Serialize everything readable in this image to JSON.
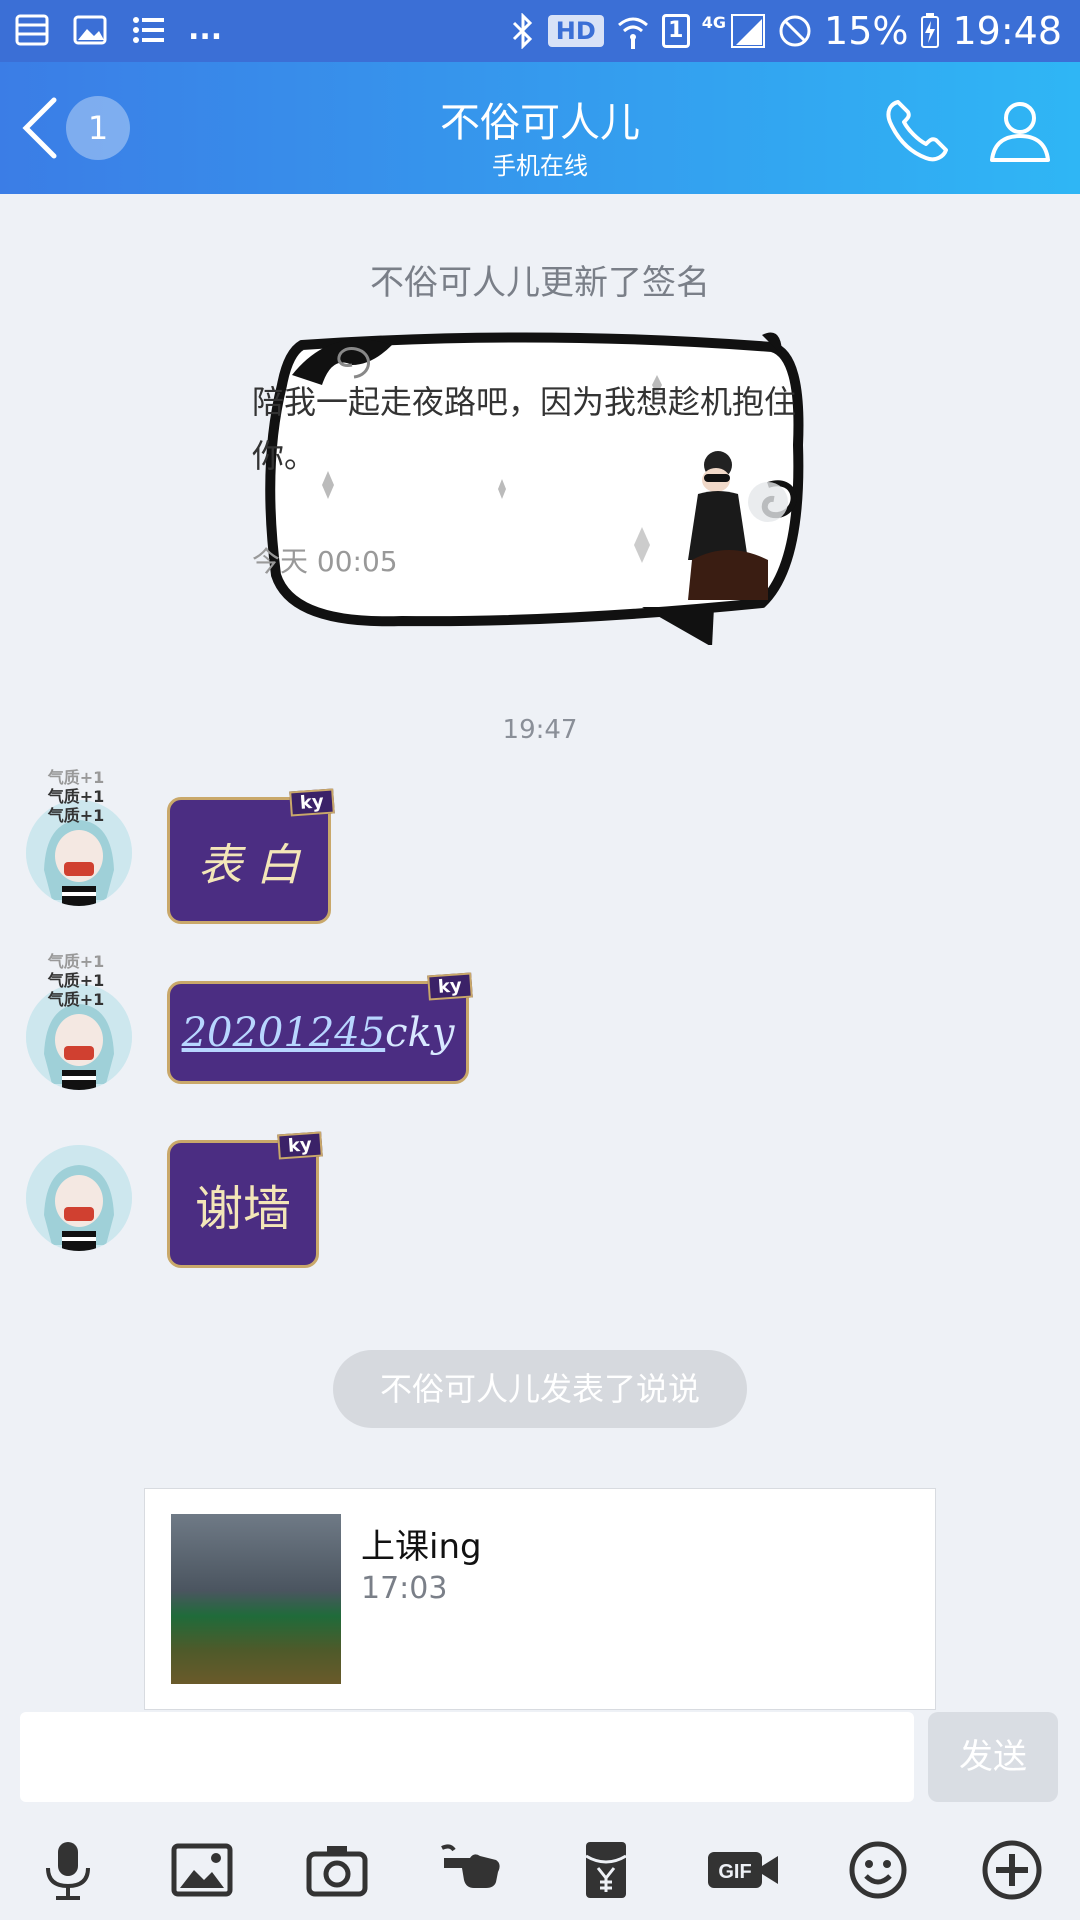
{
  "status_bar": {
    "network_badge": "HD",
    "sim_slot": "1",
    "network_type": "4G",
    "battery_percent": "15%",
    "time": "19:48",
    "overflow": "..."
  },
  "header": {
    "unread_count": "1",
    "title": "不俗可人儿",
    "subtitle": "手机在线"
  },
  "messages": {
    "signature_notice": "不俗可人儿更新了签名",
    "signature_text": "陪我一起走夜路吧，因为我想趁机抱住你。",
    "signature_time": "今天 00:05",
    "time_divider": "19:47",
    "avatar_tags": [
      "气质+1",
      "气质+1",
      "气质+1"
    ],
    "bubble_badge": "ky",
    "bubble1_text": "表 白",
    "bubble2_link": "20201245",
    "bubble2_suffix": "cky",
    "bubble3_text": "谢墙",
    "post_notice": "不俗可人儿发表了说说",
    "post_title": "上课ing",
    "post_time": "17:03"
  },
  "input": {
    "placeholder": "",
    "send_label": "发送"
  },
  "toolbar": {
    "icons": [
      "microphone-icon",
      "image-icon",
      "camera-icon",
      "poke-icon",
      "red-packet-icon",
      "gif-icon",
      "emoji-icon",
      "plus-icon"
    ],
    "gif_label": "GIF"
  },
  "colors": {
    "header_start": "#3b7de6",
    "header_end": "#2fb6f5",
    "bubble_bg": "#4b2d82",
    "bubble_border": "#c9a86a",
    "chat_bg": "#eef1f6"
  }
}
